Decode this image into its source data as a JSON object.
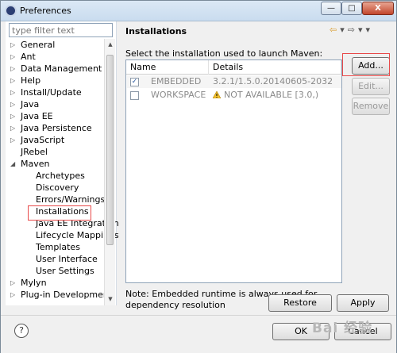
{
  "window": {
    "title": "Preferences",
    "buttons": {
      "minimize": "—",
      "maximize": "□",
      "close": "X"
    }
  },
  "sidebar": {
    "filter_placeholder": "type filter text",
    "items": [
      {
        "label": "General",
        "arrow": "▷"
      },
      {
        "label": "Ant",
        "arrow": "▷"
      },
      {
        "label": "Data Management",
        "arrow": "▷"
      },
      {
        "label": "Help",
        "arrow": "▷"
      },
      {
        "label": "Install/Update",
        "arrow": "▷"
      },
      {
        "label": "Java",
        "arrow": "▷"
      },
      {
        "label": "Java EE",
        "arrow": "▷"
      },
      {
        "label": "Java Persistence",
        "arrow": "▷"
      },
      {
        "label": "JavaScript",
        "arrow": "▷"
      },
      {
        "label": "JRebel",
        "arrow": ""
      },
      {
        "label": "Maven",
        "arrow": "◢"
      },
      {
        "label": "Archetypes",
        "arrow": ""
      },
      {
        "label": "Discovery",
        "arrow": ""
      },
      {
        "label": "Errors/Warnings",
        "arrow": ""
      },
      {
        "label": "Installations",
        "arrow": ""
      },
      {
        "label": "Java EE Integration",
        "arrow": ""
      },
      {
        "label": "Lifecycle Mappings",
        "arrow": ""
      },
      {
        "label": "Templates",
        "arrow": ""
      },
      {
        "label": "User Interface",
        "arrow": ""
      },
      {
        "label": "User Settings",
        "arrow": ""
      },
      {
        "label": "Mylyn",
        "arrow": "▷"
      },
      {
        "label": "Plug-in Development",
        "arrow": "▷"
      }
    ]
  },
  "page": {
    "title": "Installations",
    "nav": {
      "back": "⇦",
      "back_menu": "▾",
      "forward": "⇨",
      "forward_menu": "▾",
      "view_menu": "▾"
    },
    "description": "Select the installation used to launch Maven:",
    "table": {
      "columns": [
        "Name",
        "Details"
      ],
      "rows": [
        {
          "checked": "✓",
          "name": "EMBEDDED",
          "details": "3.2.1/1.5.0.20140605-2032"
        },
        {
          "checked": "",
          "name": "WORKSPACE",
          "details": "NOT AVAILABLE [3.0,)"
        }
      ]
    },
    "side_buttons": {
      "add": "Add...",
      "edit": "Edit...",
      "remove": "Remove"
    },
    "note": "Note: Embedded runtime is always used for dependency resolution",
    "restore_defaults": "Restore Defaults",
    "apply": "Apply"
  },
  "footer": {
    "help": "?",
    "ok": "OK",
    "cancel": "Cancel",
    "watermark": "Bai 经验"
  },
  "colors": {
    "highlight": "#e84a4a",
    "accent": "#2b3f74"
  }
}
